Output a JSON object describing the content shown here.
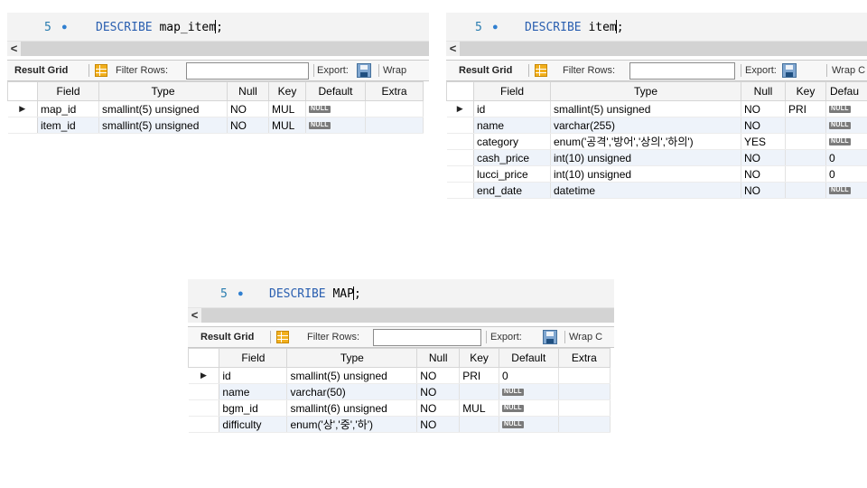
{
  "toolbar": {
    "result_grid": "Result Grid",
    "filter_rows": "Filter Rows:",
    "export": "Export:",
    "wrap": "Wrap",
    "wrap_cut": "Wrap C",
    "scroll_left": "<"
  },
  "colors": {
    "keyword": "#2a5fb0",
    "line_number": "#2a7db0",
    "breakpoint_dot": "#2f7fd0",
    "null_badge": "#7a7a7a",
    "alt_row": "#eef3fa"
  },
  "panels": [
    {
      "line_no": "5",
      "bullet": "●",
      "keyword": "DESCRIBE",
      "table_name": "map_item",
      "terminator": ";",
      "headers": [
        "Field",
        "Type",
        "Null",
        "Key",
        "Default",
        "Extra"
      ],
      "rows": [
        [
          "map_id",
          "smallint(5) unsigned",
          "NO",
          "MUL",
          "NULL",
          ""
        ],
        [
          "item_id",
          "smallint(5) unsigned",
          "NO",
          "MUL",
          "NULL",
          ""
        ]
      ]
    },
    {
      "line_no": "5",
      "bullet": "●",
      "keyword": "DESCRIBE",
      "table_name": "item",
      "terminator": ";",
      "headers": [
        "Field",
        "Type",
        "Null",
        "Key",
        "Defau"
      ],
      "rows": [
        [
          "id",
          "smallint(5) unsigned",
          "NO",
          "PRI",
          "NULL"
        ],
        [
          "name",
          "varchar(255)",
          "NO",
          "",
          "NULL"
        ],
        [
          "category",
          "enum('공격','방어','상의','하의')",
          "YES",
          "",
          "NULL"
        ],
        [
          "cash_price",
          "int(10) unsigned",
          "NO",
          "",
          "0"
        ],
        [
          "lucci_price",
          "int(10) unsigned",
          "NO",
          "",
          "0"
        ],
        [
          "end_date",
          "datetime",
          "NO",
          "",
          "NULL"
        ]
      ]
    },
    {
      "line_no": "5",
      "bullet": "●",
      "keyword": "DESCRIBE",
      "table_name": "MAP",
      "terminator": ";",
      "headers": [
        "Field",
        "Type",
        "Null",
        "Key",
        "Default",
        "Extra"
      ],
      "rows": [
        [
          "id",
          "smallint(5) unsigned",
          "NO",
          "PRI",
          "0",
          ""
        ],
        [
          "name",
          "varchar(50)",
          "NO",
          "",
          "NULL",
          ""
        ],
        [
          "bgm_id",
          "smallint(6) unsigned",
          "NO",
          "MUL",
          "NULL",
          ""
        ],
        [
          "difficulty",
          "enum('상','중','하')",
          "NO",
          "",
          "NULL",
          ""
        ]
      ]
    }
  ],
  "row_marker": "▶"
}
